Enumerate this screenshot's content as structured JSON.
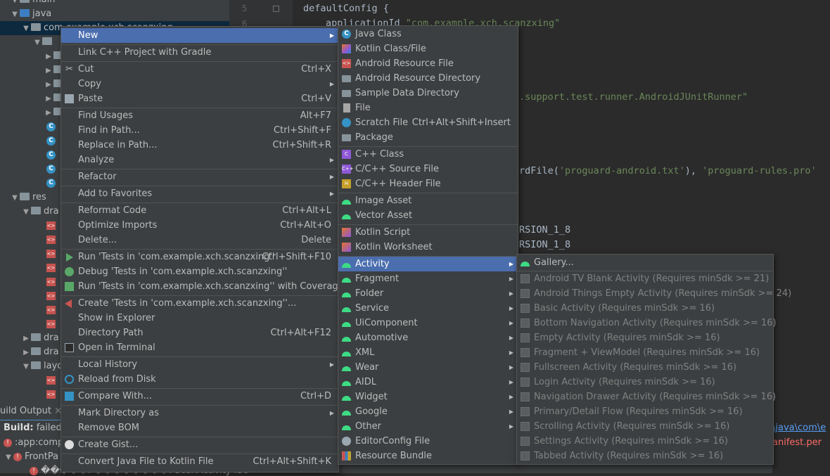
{
  "project_tree": {
    "main_label": "main",
    "java_label": "java",
    "package_label": "com.example.xch.scanzxing",
    "res_label": "res",
    "drawable_label": "dra",
    "drawable2_label": "dra",
    "drawable3_label": "dra",
    "layout_label": "layo"
  },
  "editor": {
    "line_numbers": [
      "5",
      "6"
    ],
    "lines": {
      "l1": "defaultConfig {",
      "l2_key": "applicationId ",
      "l2_val": "\"com.example.xch.scanzxing\"",
      "l3_val": ".support.test.runner.AndroidJUnitRunner\"",
      "l4_pre": "rdFile(",
      "l4_s1": "'proguard-android.txt'",
      "l4_mid": "), ",
      "l4_s2": "'proguard-rules.pro'",
      "l5": "RSION_1_8",
      "l6": "RSION_1_8"
    }
  },
  "build_panel": {
    "tab_label": "uild Output",
    "tab_close": "×",
    "build_label": "Build:",
    "build_status": " failed a",
    "task_label": ":app:comp",
    "front_label": "FrontPa",
    "bottom_label": "�����: ��������: ScanActivity :36",
    "right_path": "\\java\\com\\e",
    "right_manifest": "anifest.per"
  },
  "context_menu": {
    "items": [
      {
        "label": "New",
        "shortcut": "",
        "sub": true
      },
      {
        "label": "Link C++ Project with Gradle",
        "shortcut": ""
      },
      {
        "label": "Cut",
        "shortcut": "Ctrl+X"
      },
      {
        "label": "Copy",
        "shortcut": "",
        "sub": true
      },
      {
        "label": "Paste",
        "shortcut": "Ctrl+V"
      },
      {
        "label": "Find Usages",
        "shortcut": "Alt+F7"
      },
      {
        "label": "Find in Path...",
        "shortcut": "Ctrl+Shift+F"
      },
      {
        "label": "Replace in Path...",
        "shortcut": "Ctrl+Shift+R"
      },
      {
        "label": "Analyze",
        "shortcut": "",
        "sub": true
      },
      {
        "label": "Refactor",
        "shortcut": "",
        "sub": true
      },
      {
        "label": "Add to Favorites",
        "shortcut": "",
        "sub": true
      },
      {
        "label": "Reformat Code",
        "shortcut": "Ctrl+Alt+L"
      },
      {
        "label": "Optimize Imports",
        "shortcut": "Ctrl+Alt+O"
      },
      {
        "label": "Delete...",
        "shortcut": "Delete"
      },
      {
        "label": "Run 'Tests in 'com.example.xch.scanzxing''",
        "shortcut": "Ctrl+Shift+F10"
      },
      {
        "label": "Debug 'Tests in 'com.example.xch.scanzxing''",
        "shortcut": ""
      },
      {
        "label": "Run 'Tests in 'com.example.xch.scanzxing'' with Coverage",
        "shortcut": ""
      },
      {
        "label": "Create 'Tests in 'com.example.xch.scanzxing''...",
        "shortcut": ""
      },
      {
        "label": "Show in Explorer",
        "shortcut": ""
      },
      {
        "label": "Directory Path",
        "shortcut": "Ctrl+Alt+F12"
      },
      {
        "label": "Open in Terminal",
        "shortcut": ""
      },
      {
        "label": "Local History",
        "shortcut": "",
        "sub": true
      },
      {
        "label": "Reload from Disk",
        "shortcut": ""
      },
      {
        "label": "Compare With...",
        "shortcut": "Ctrl+D"
      },
      {
        "label": "Mark Directory as",
        "shortcut": "",
        "sub": true
      },
      {
        "label": "Remove BOM",
        "shortcut": ""
      },
      {
        "label": "Create Gist...",
        "shortcut": ""
      },
      {
        "label": "Convert Java File to Kotlin File",
        "shortcut": "Ctrl+Alt+Shift+K"
      }
    ]
  },
  "new_menu": {
    "items": [
      {
        "label": "Java Class"
      },
      {
        "label": "Kotlin Class/File"
      },
      {
        "label": "Android Resource File"
      },
      {
        "label": "Android Resource Directory"
      },
      {
        "label": "Sample Data Directory"
      },
      {
        "label": "File"
      },
      {
        "label": "Scratch File",
        "shortcut": "Ctrl+Alt+Shift+Insert"
      },
      {
        "label": "Package"
      },
      {
        "label": "C++ Class"
      },
      {
        "label": "C/C++ Source File"
      },
      {
        "label": "C/C++ Header File"
      },
      {
        "label": "Image Asset"
      },
      {
        "label": "Vector Asset"
      },
      {
        "label": "Kotlin Script"
      },
      {
        "label": "Kotlin Worksheet"
      },
      {
        "label": "Activity",
        "sub": true
      },
      {
        "label": "Fragment",
        "sub": true
      },
      {
        "label": "Folder",
        "sub": true
      },
      {
        "label": "Service",
        "sub": true
      },
      {
        "label": "UiComponent",
        "sub": true
      },
      {
        "label": "Automotive",
        "sub": true
      },
      {
        "label": "XML",
        "sub": true
      },
      {
        "label": "Wear",
        "sub": true
      },
      {
        "label": "AIDL",
        "sub": true
      },
      {
        "label": "Widget",
        "sub": true
      },
      {
        "label": "Google",
        "sub": true
      },
      {
        "label": "Other",
        "sub": true
      },
      {
        "label": "EditorConfig File"
      },
      {
        "label": "Resource Bundle"
      }
    ]
  },
  "activity_menu": {
    "items": [
      {
        "label": "Gallery..."
      },
      {
        "label": "Android TV Blank Activity (Requires minSdk >= 21)"
      },
      {
        "label": "Android Things Empty Activity (Requires minSdk >= 24)"
      },
      {
        "label": "Basic Activity (Requires minSdk >= 16)"
      },
      {
        "label": "Bottom Navigation Activity (Requires minSdk >= 16)"
      },
      {
        "label": "Empty Activity (Requires minSdk >= 16)"
      },
      {
        "label": "Fragment + ViewModel (Requires minSdk >= 16)"
      },
      {
        "label": "Fullscreen Activity (Requires minSdk >= 16)"
      },
      {
        "label": "Login Activity (Requires minSdk >= 16)"
      },
      {
        "label": "Navigation Drawer Activity (Requires minSdk >= 16)"
      },
      {
        "label": "Primary/Detail Flow (Requires minSdk >= 16)"
      },
      {
        "label": "Scrolling Activity (Requires minSdk >= 16)"
      },
      {
        "label": "Settings Activity (Requires minSdk >= 16)"
      },
      {
        "label": "Tabbed Activity (Requires minSdk >= 16)"
      }
    ]
  }
}
